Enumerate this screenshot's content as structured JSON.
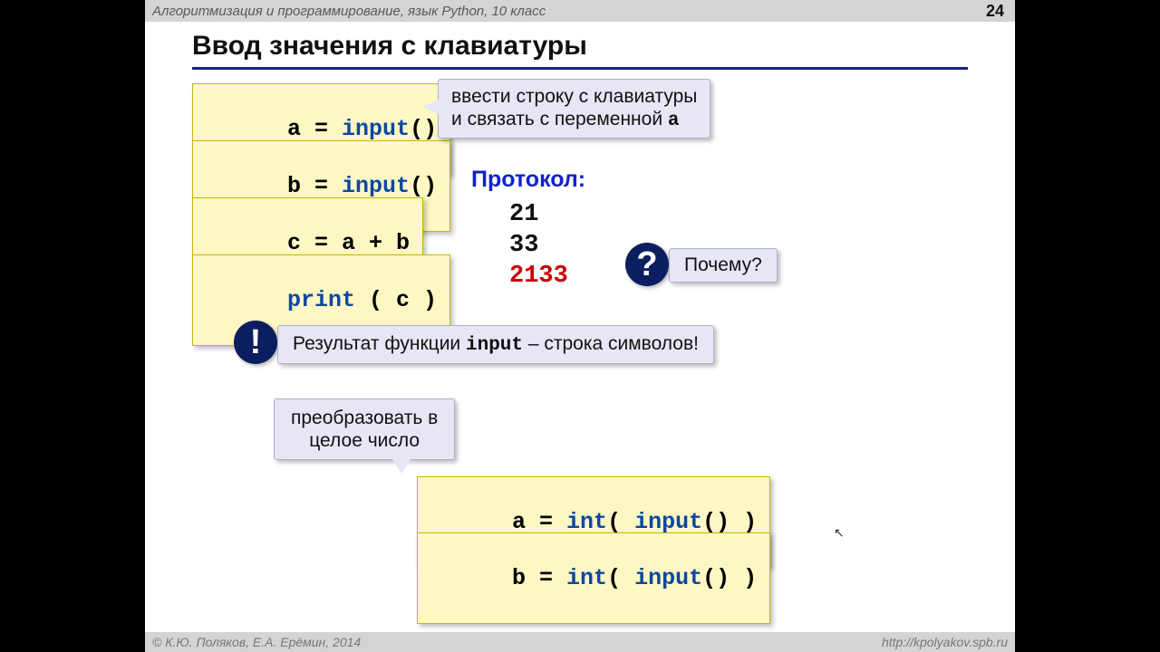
{
  "header": {
    "title": "Алгоритмизация и программирование, язык Python, 10 класс",
    "page": "24"
  },
  "slide": {
    "title": "Ввод значения с клавиатуры",
    "code1_a": "a",
    "code1_eq": " = ",
    "code1_fn": "input",
    "code1_paren": "()",
    "code2_a": "b",
    "code2_eq": " = ",
    "code2_fn": "input",
    "code2_paren": "()",
    "code3": "c = a + b",
    "code4_fn": "print",
    "code4_rest": " ( c )",
    "callout_input_l1": "ввести строку с клавиатуры",
    "callout_input_l2_a": "и связать с переменной ",
    "callout_input_l2_b": "a",
    "proto_label": "Протокол:",
    "proto1": "21",
    "proto2": "33",
    "proto3": "2133",
    "why": "Почему?",
    "result_a": "Результат функции ",
    "result_b": "input",
    "result_c": " – строка символов!",
    "convert_l1": "преобразовать в",
    "convert_l2": "целое число",
    "code5_a": "a",
    "code5_eq": " = ",
    "code5_fn1": "int",
    "code5_mid": "( ",
    "code5_fn2": "input",
    "code5_end": "() )",
    "code6_a": "b",
    "code6_eq": " = ",
    "code6_fn1": "int",
    "code6_mid": "( ",
    "code6_fn2": "input",
    "code6_end": "() )"
  },
  "footer": {
    "copyright": "© К.Ю. Поляков, Е.А. Ерёмин, 2014",
    "url": "http://kpolyakov.spb.ru"
  }
}
